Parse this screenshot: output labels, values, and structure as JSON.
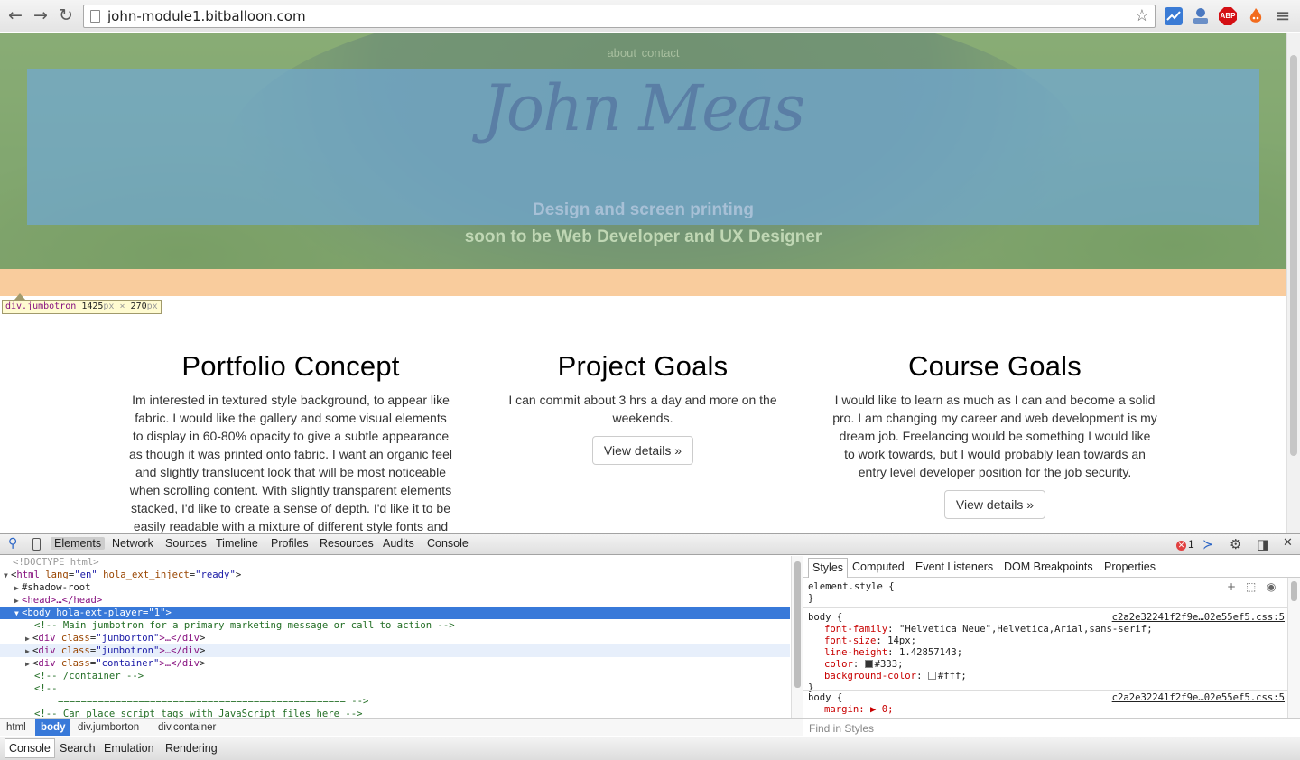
{
  "browser": {
    "url": "john-module1.bitballoon.com",
    "back_glyph": "←",
    "forward_glyph": "→",
    "reload_glyph": "↻",
    "star_glyph": "☆",
    "menu_glyph": "≡",
    "extensions": [
      {
        "name": "stats-extension-icon",
        "label": "",
        "color": "#3a7bd5"
      },
      {
        "name": "user-extension-icon",
        "label": "",
        "color": "#6a8fc7"
      },
      {
        "name": "adblock-icon",
        "label": "ABP",
        "color": "#d40f14"
      },
      {
        "name": "hola-icon",
        "label": "",
        "color": "#f26b1d"
      }
    ]
  },
  "site": {
    "nav": [
      "about",
      "contact"
    ],
    "brand": "John Meas",
    "tagline_1": "Design and screen printing",
    "tagline_2": "soon to be Web Developer and UX Designer",
    "inspect_tooltip": {
      "selector": "div.jumbotron",
      "width": "1425",
      "height": "270",
      "unit": "px",
      "times": "×"
    },
    "highlight_colors": {
      "margin": "#f6b26b",
      "padding": "#93c47d",
      "content": "#6fa8dc"
    },
    "columns": [
      {
        "heading": "Portfolio Concept",
        "text": "Im interested in textured style background, to appear like fabric. I would like the gallery and some visual elements to display in 60-80% opacity to give a subtle appearance as though it was printed onto fabric. I want an organic feel and slightly translucent look that will be most noticeable when scrolling content. With slightly transparent elements stacked, I'd like to create a sense of depth. I'd like it to be easily readable with a mixture of different style fonts and",
        "button": ""
      },
      {
        "heading": "Project Goals",
        "text": "I can commit about 3 hrs a day and more on the weekends.",
        "button": "View details »"
      },
      {
        "heading": "Course Goals",
        "text": "I would like to learn as much as I can and become a solid pro. I am changing my career and web development is my dream job. Freelancing would be something I would like to work towards, but I would probably lean towards an entry level developer position for the job security.",
        "button": "View details »"
      }
    ]
  },
  "devtools": {
    "tabs": [
      "Elements",
      "Network",
      "Sources",
      "Timeline",
      "Profiles",
      "Resources",
      "Audits",
      "Console"
    ],
    "active_tab": "Elements",
    "error_count": "1",
    "dom": {
      "doctype": "<!DOCTYPE html>",
      "html_tag": "html",
      "html_attr1_name": "lang",
      "html_attr1_value": "\"en\"",
      "html_attr2_name": "hola_ext_inject",
      "html_attr2_value": "\"ready\"",
      "shadow_root": "#shadow-root",
      "head": "<head>…</head>",
      "body_tag": "body",
      "body_attr_name": "hola-ext-player",
      "body_attr_value": "\"1\"",
      "comment_main": "<!-- Main jumbotron for a primary marketing message or call to action -->",
      "div1_class": "\"jumborton\"",
      "div2_class": "\"jumbotron\"",
      "div3_class": "\"container\"",
      "div_tag": "div",
      "class_attr": "class",
      "collapsed": ">…</",
      "comment_container": "<!-- /container -->",
      "comment_open": "<!--",
      "comment_rule": "================================================== -->",
      "comment_scripts": "<!-- Can place script tags with JavaScript files here -->"
    },
    "breadcrumb": [
      "html",
      "body",
      "div.jumborton",
      "div.container"
    ],
    "breadcrumb_active": "body",
    "styles_tabs": [
      "Styles",
      "Computed",
      "Event Listeners",
      "DOM Breakpoints",
      "Properties"
    ],
    "styles": {
      "element_style": "element.style {",
      "close_brace": "}",
      "rule1_selector": "body {",
      "rule1_source": "c2a2e32241f2f9e…02e55ef5.css:5",
      "props": [
        {
          "name": "font-family",
          "value": "\"Helvetica Neue\",Helvetica,Arial,sans-serif;"
        },
        {
          "name": "font-size",
          "value": "14px;"
        },
        {
          "name": "line-height",
          "value": "1.42857143;"
        },
        {
          "name": "color",
          "value": "#333;",
          "swatch": "#333333"
        },
        {
          "name": "background-color",
          "value": "#fff;",
          "swatch": "#ffffff"
        }
      ],
      "rule2_selector": "body {",
      "rule2_source": "c2a2e32241f2f9e…02e55ef5.css:5",
      "rule2_partial": "margin: ▶ 0;",
      "find_placeholder": "Find in Styles"
    },
    "drawer_tabs": [
      "Console",
      "Search",
      "Emulation",
      "Rendering"
    ],
    "drawer_active": "Console"
  }
}
